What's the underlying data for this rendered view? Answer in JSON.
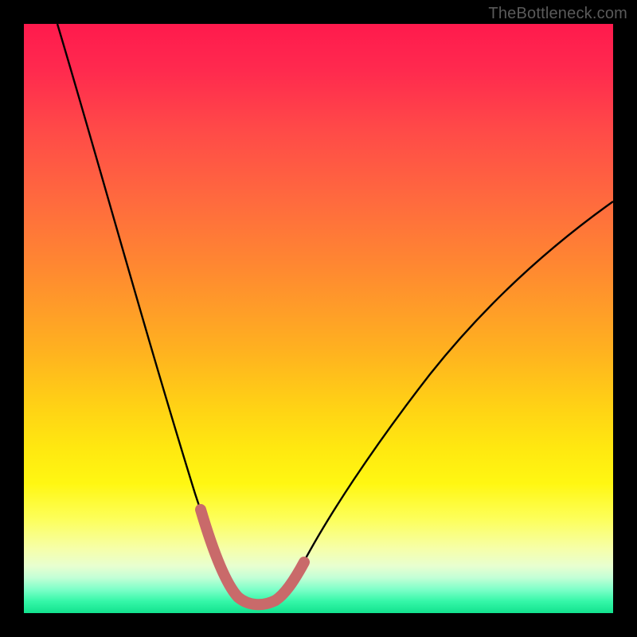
{
  "watermark": "TheBottleneck.com",
  "colors": {
    "frame": "#000000",
    "curve": "#000000",
    "highlight": "#c96a6a",
    "bottom_band": "#12e28e"
  },
  "chart_data": {
    "type": "line",
    "title": "",
    "xlabel": "",
    "ylabel": "",
    "xlim": [
      0,
      100
    ],
    "ylim": [
      0,
      100
    ],
    "annotations": [],
    "series": [
      {
        "name": "bottleneck-curve",
        "x": [
          0,
          5,
          10,
          15,
          20,
          25,
          28,
          30,
          32,
          34,
          36,
          38,
          40,
          42,
          45,
          50,
          55,
          60,
          65,
          70,
          75,
          80,
          85,
          90,
          95,
          100
        ],
        "values": [
          100,
          83,
          67,
          52,
          38,
          25,
          18,
          13,
          8,
          5,
          3,
          2,
          2,
          2,
          3,
          6,
          11,
          18,
          26,
          34,
          42,
          49,
          55,
          60,
          64,
          67
        ]
      }
    ],
    "highlight_range_x": [
      30,
      46
    ],
    "optimal_x": 40,
    "background_gradient": [
      {
        "pos": 0,
        "meaning": "severe-bottleneck",
        "color": "#ff1a4d"
      },
      {
        "pos": 50,
        "meaning": "moderate",
        "color": "#ffd215"
      },
      {
        "pos": 100,
        "meaning": "no-bottleneck",
        "color": "#12e28e"
      }
    ]
  }
}
